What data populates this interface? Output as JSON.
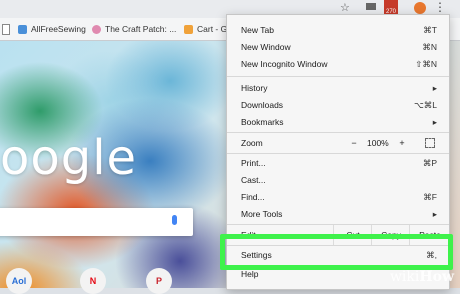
{
  "bookmarks": [
    {
      "label": "AllFreeSewing",
      "color": "#4a90d9"
    },
    {
      "label": "The Craft Patch: ...",
      "color": "#e08ab0"
    },
    {
      "label": "Cart - G",
      "color": "#f0a23a"
    }
  ],
  "toolbar": {
    "badge": "270"
  },
  "menu": {
    "new_tab": {
      "label": "New Tab",
      "shortcut": "⌘T"
    },
    "new_window": {
      "label": "New Window",
      "shortcut": "⌘N"
    },
    "incognito": {
      "label": "New Incognito Window",
      "shortcut": "⇧⌘N"
    },
    "history": {
      "label": "History"
    },
    "downloads": {
      "label": "Downloads",
      "shortcut": "⌥⌘L"
    },
    "bookmarks": {
      "label": "Bookmarks"
    },
    "zoom": {
      "label": "Zoom",
      "minus": "−",
      "value": "100%",
      "plus": "+"
    },
    "print": {
      "label": "Print...",
      "shortcut": "⌘P"
    },
    "cast": {
      "label": "Cast..."
    },
    "find": {
      "label": "Find...",
      "shortcut": "⌘F"
    },
    "more_tools": {
      "label": "More Tools"
    },
    "edit": {
      "label": "Edit",
      "cut": "Cut",
      "copy": "Copy",
      "paste": "Paste"
    },
    "settings": {
      "label": "Settings",
      "shortcut": "⌘,"
    },
    "help": {
      "label": "Help"
    }
  },
  "page": {
    "logo_text": "oogle"
  },
  "watermark": {
    "prefix": "wiki",
    "suffix": "How"
  }
}
